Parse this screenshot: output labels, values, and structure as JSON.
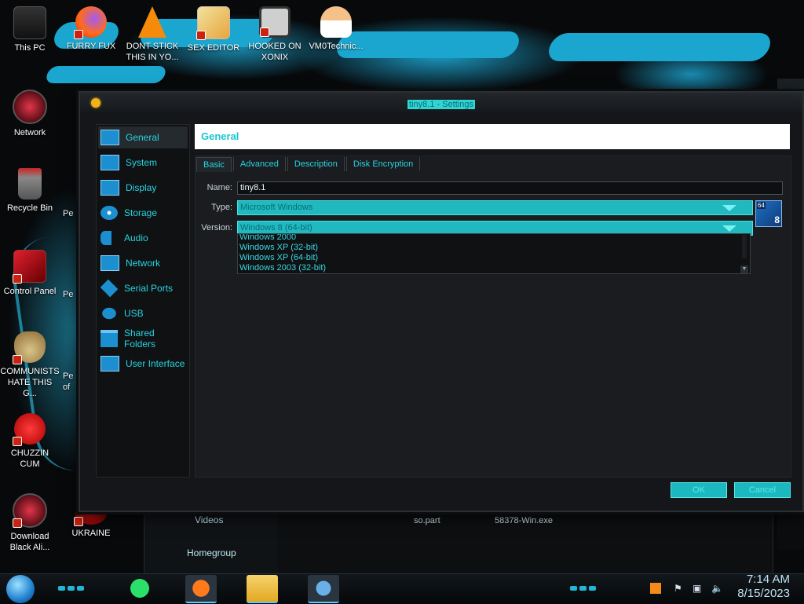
{
  "desktop": {
    "icons": [
      {
        "label": "This PC",
        "icon": "computer-icon"
      },
      {
        "label": "FURRY FUX",
        "icon": "firefox-icon"
      },
      {
        "label": "DONT STICK THIS IN YO...",
        "icon": "vlc-cone-icon"
      },
      {
        "label": "SEX EDITOR",
        "icon": "hxd-icon"
      },
      {
        "label": "HOOKED ON XONIX",
        "icon": "xonix-game-icon"
      },
      {
        "label": "VM0Technic...",
        "icon": "doctor-avatar-icon"
      },
      {
        "label": "Network",
        "icon": "network-orb-icon"
      },
      {
        "label": "Recycle Bin",
        "icon": "recycle-bin-icon"
      },
      {
        "label": "Control Panel",
        "icon": "control-panel-icon"
      },
      {
        "label": "COMMUNISTS HATE THIS G...",
        "icon": "money-bag-icon"
      },
      {
        "label": "CHUZZIN CUM",
        "icon": "chuzzle-icon"
      },
      {
        "label": "Download Black Ali...",
        "icon": "download-orb-icon"
      },
      {
        "label": "UKRAINE",
        "icon": "ukraine-icon"
      }
    ],
    "partial_labels": {
      "pe1": "Pe",
      "pe2": "Pe",
      "pe3": "Pe",
      "of": "of"
    }
  },
  "window": {
    "title": "tiny8.1 - Settings",
    "sidebar": [
      {
        "label": "General",
        "icon": "monitor-icon"
      },
      {
        "label": "System",
        "icon": "chip-icon"
      },
      {
        "label": "Display",
        "icon": "display-icon"
      },
      {
        "label": "Storage",
        "icon": "disc-icon"
      },
      {
        "label": "Audio",
        "icon": "speaker-icon"
      },
      {
        "label": "Network",
        "icon": "network-icon"
      },
      {
        "label": "Serial Ports",
        "icon": "serial-port-icon"
      },
      {
        "label": "USB",
        "icon": "usb-icon"
      },
      {
        "label": "Shared Folders",
        "icon": "folder-icon"
      },
      {
        "label": "User Interface",
        "icon": "window-icon"
      }
    ],
    "section_title": "General",
    "tabs": [
      "Basic",
      "Advanced",
      "Description",
      "Disk Encryption"
    ],
    "form": {
      "name_label": "Name:",
      "name_value": "tiny8.1",
      "type_label": "Type:",
      "type_value": "Microsoft Windows",
      "version_label": "Version:",
      "version_value": "Windows 8 (64-bit)",
      "os_badge_64": "64",
      "os_badge_ver": "8"
    },
    "version_dropdown": [
      "Windows 2000",
      "Windows XP (32-bit)",
      "Windows XP (64-bit)",
      "Windows 2003 (32-bit)"
    ],
    "ok_label": "OK",
    "cancel_label": "Cancel"
  },
  "explorer_behind": {
    "nav": [
      "Videos",
      "Homegroup"
    ],
    "files": [
      "so.part",
      "58378-Win.exe"
    ]
  },
  "taskbar": {
    "apps": [
      "spotify-icon",
      "firefox-icon",
      "file-explorer-icon",
      "virtualbox-icon"
    ],
    "tray": [
      "sublime-icon",
      "flag-icon",
      "network-icon",
      "volume-icon"
    ],
    "time": "7:14 AM",
    "date": "8/15/2023"
  },
  "colors": {
    "accent": "#1fb9bf",
    "accent_text": "#28d4e0"
  }
}
